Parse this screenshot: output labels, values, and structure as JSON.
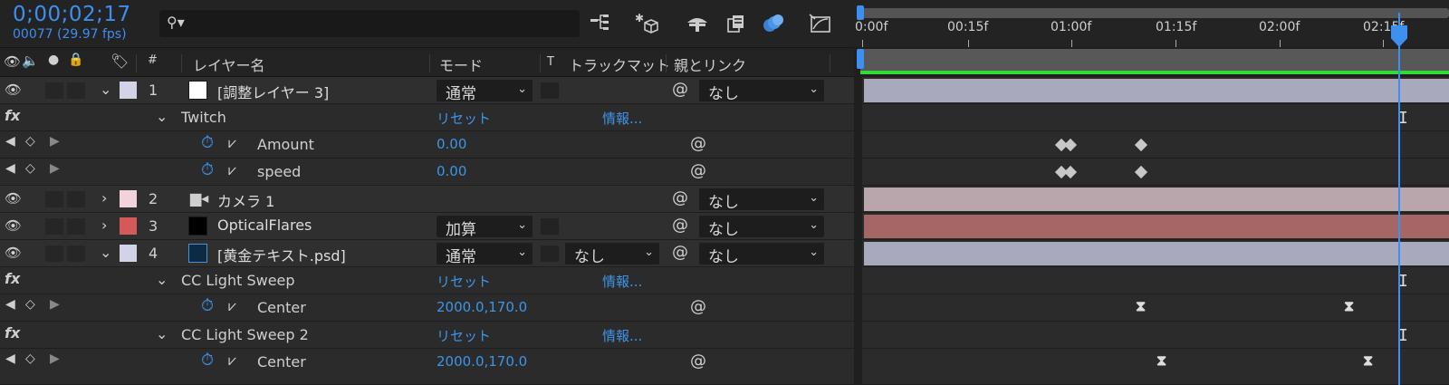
{
  "header": {
    "timecode": "0;00;02;17",
    "frames": "00077 (29.97 fps)",
    "search_placeholder": ""
  },
  "toolbar_icons": [
    "flowchart-icon",
    "draft-3d-icon",
    "shy-layers-icon",
    "frame-blending-icon",
    "motion-blur-icon",
    "graph-editor-icon"
  ],
  "columns": {
    "hash": "#",
    "layer_name": "レイヤー名",
    "mode": "モード",
    "t": "T",
    "track_matte": "トラックマット",
    "parent_link": "親とリンク"
  },
  "timeline": {
    "ticks": [
      "0:00f",
      "00:15f",
      "01:00f",
      "01:15f",
      "02:00f",
      "02:15f"
    ]
  },
  "rows": {
    "layer1": {
      "num": "1",
      "name": "[調整レイヤー 3]",
      "mode": "通常",
      "parent": "なし",
      "swatch": "#d3d3e8",
      "bar": "#a9a9bd"
    },
    "twitch": {
      "name": "Twitch",
      "reset": "リセット",
      "info": "情報..."
    },
    "amount": {
      "name": "Amount",
      "value": "0.00"
    },
    "speed": {
      "name": "speed",
      "value": "0.00"
    },
    "layer2": {
      "num": "2",
      "name": "カメラ 1",
      "parent": "なし",
      "swatch": "#f2d3dc",
      "bar": "#b9a5ac"
    },
    "layer3": {
      "num": "3",
      "name": "OpticalFlares",
      "mode": "加算",
      "parent": "なし",
      "swatch": "#d45a5a",
      "bar": "#a56666"
    },
    "layer4": {
      "num": "4",
      "name": "[黄金テキスト.psd]",
      "mode": "通常",
      "matte": "なし",
      "parent": "なし",
      "swatch": "#d3d3e8",
      "bar": "#a9a9bd"
    },
    "sweep1": {
      "name": "CC Light Sweep",
      "reset": "リセット",
      "info": "情報..."
    },
    "center1": {
      "name": "Center",
      "value": "2000.0,170.0"
    },
    "sweep2": {
      "name": "CC Light Sweep 2",
      "reset": "リセット",
      "info": "情報..."
    },
    "center2": {
      "name": "Center",
      "value": "2000.0,170.0"
    }
  },
  "fx_label": "fx"
}
